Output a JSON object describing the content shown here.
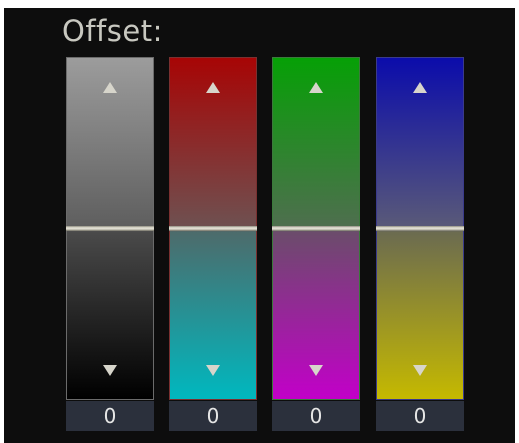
{
  "panel": {
    "title": "Offset:"
  },
  "sliders": [
    {
      "channel": "gray",
      "value": "0",
      "position": 0.5,
      "up_icon": "triangle-up-icon",
      "down_icon": "triangle-down-icon"
    },
    {
      "channel": "red",
      "value": "0",
      "position": 0.5,
      "up_icon": "triangle-up-icon",
      "down_icon": "triangle-down-icon"
    },
    {
      "channel": "green",
      "value": "0",
      "position": 0.5,
      "up_icon": "triangle-up-icon",
      "down_icon": "triangle-down-icon"
    },
    {
      "channel": "blue",
      "value": "0",
      "position": 0.5,
      "up_icon": "triangle-up-icon",
      "down_icon": "triangle-down-icon"
    }
  ],
  "colors": {
    "gray": "#9c9c9c",
    "red": "#a70505",
    "green": "#06a006",
    "blue": "#0b0cab",
    "cyan": "#00b8bf",
    "magenta": "#c200c8",
    "yellow": "#c5b900"
  }
}
